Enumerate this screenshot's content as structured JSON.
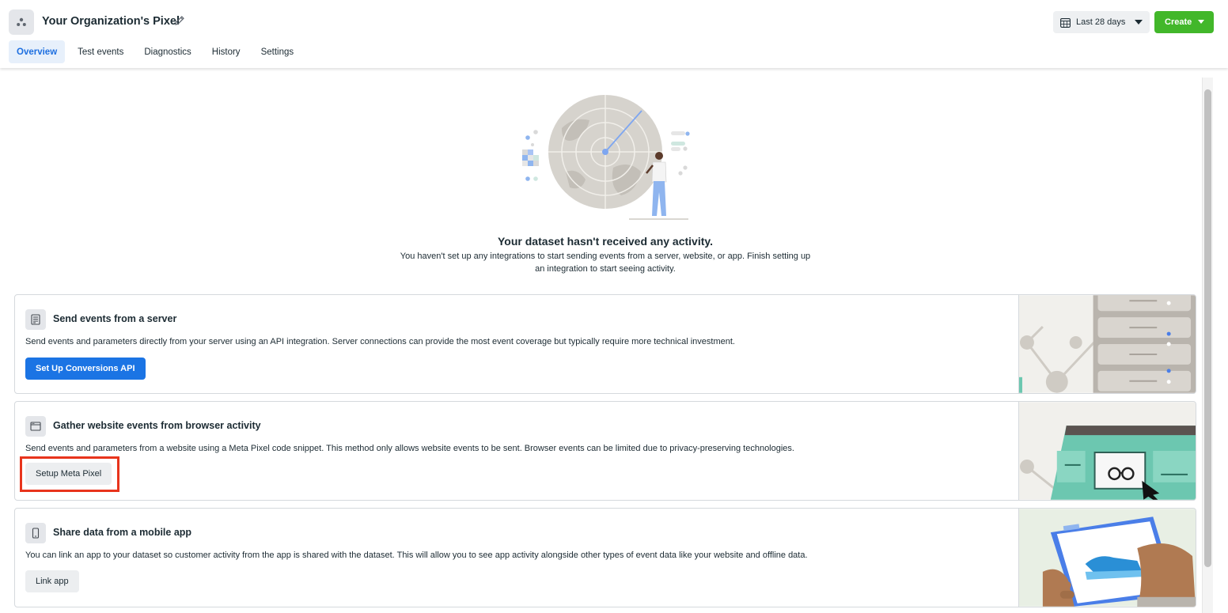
{
  "header": {
    "title": "Your Organization's Pixel",
    "tabs": [
      {
        "label": "Overview",
        "active": true
      },
      {
        "label": "Test events",
        "active": false
      },
      {
        "label": "Diagnostics",
        "active": false
      },
      {
        "label": "History",
        "active": false
      },
      {
        "label": "Settings",
        "active": false
      }
    ],
    "date_range": "Last 28 days",
    "create_label": "Create"
  },
  "empty_state": {
    "title": "Your dataset hasn't received any activity.",
    "description": "You haven't set up any integrations to start sending events from a server, website, or app. Finish setting up an integration to start seeing activity."
  },
  "cards": [
    {
      "title": "Send events from a server",
      "description": "Send events and parameters directly from your server using an API integration. Server connections can provide the most event coverage but typically require more technical investment.",
      "button": "Set Up Conversions API",
      "icon": "server-icon"
    },
    {
      "title": "Gather website events from browser activity",
      "description": "Send events and parameters from a website using a Meta Pixel code snippet. This method only allows website events to be sent. Browser events can be limited due to privacy-preserving technologies.",
      "button": "Setup Meta Pixel",
      "icon": "browser-window-icon"
    },
    {
      "title": "Share data from a mobile app",
      "description": "You can link an app to your dataset so customer activity from the app is shared with the dataset. This will allow you to see app activity alongside other types of event data like your website and offline data.",
      "button": "Link app",
      "icon": "mobile-phone-icon"
    }
  ],
  "colors": {
    "accent_blue": "#1b74e4",
    "create_green": "#42b72a",
    "highlight_red": "#e8341c",
    "tab_active_bg": "#e7f0fb"
  }
}
